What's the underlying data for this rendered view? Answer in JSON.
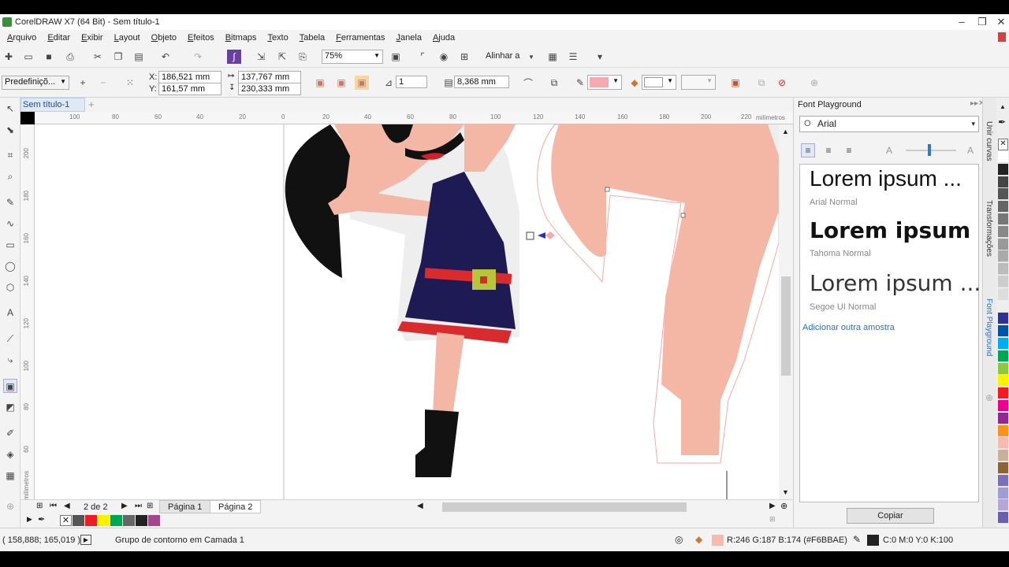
{
  "app": {
    "title": "CorelDRAW X7 (64 Bit) - Sem título-1"
  },
  "menu": [
    "Arquivo",
    "Editar",
    "Exibir",
    "Layout",
    "Objeto",
    "Efeitos",
    "Bitmaps",
    "Texto",
    "Tabela",
    "Ferramentas",
    "Janela",
    "Ajuda"
  ],
  "toolbar": {
    "zoom": "75%",
    "align_label": "Alinhar a"
  },
  "propbar": {
    "preset": "Predefiniçõ...",
    "x_label": "X:",
    "x": "186,521 mm",
    "y_label": "Y:",
    "y": "161,57 mm",
    "w": "137,767 mm",
    "h": "230,333 mm",
    "steps": "1",
    "offset": "8,368 mm"
  },
  "doc": {
    "tab": "Sem título-1"
  },
  "ruler": {
    "h_ticks": [
      "100",
      "80",
      "60",
      "40",
      "20",
      "0",
      "20",
      "40",
      "60",
      "80",
      "100",
      "120",
      "140",
      "160",
      "180",
      "200",
      "220"
    ],
    "h_unit": "milímetros",
    "v_ticks": [
      "200",
      "180",
      "160",
      "140",
      "120",
      "100",
      "80",
      "60"
    ],
    "v_unit": "milímetros"
  },
  "pages": {
    "counter": "2 de 2",
    "page1": "Página 1",
    "page2": "Página 2"
  },
  "status": {
    "coords": "( 158,888; 165,019 )",
    "message": "Grupo de contorno em Camada 1",
    "fill": "R:246 G:187 B:174 (#F6BBAE)",
    "outline": "C:0 M:0 Y:0 K:100",
    "fill_color": "#F6BBAE",
    "outline_color": "#222222"
  },
  "docker": {
    "title": "Font Playground",
    "font": "Arial",
    "samples": [
      {
        "text": "Lorem ipsum ...",
        "font": "Arial Normal"
      },
      {
        "text": "Lorem ipsum ...",
        "font": "Tahoma Normal"
      },
      {
        "text": "Lorem ipsum ...",
        "font": "Segoe UI Normal"
      }
    ],
    "add_sample": "Adicionar outra amostra",
    "copy": "Copiar"
  },
  "docker_tabs": [
    "Unir curvas",
    "Transformações",
    "Font Playground"
  ],
  "palette": {
    "bottom": [
      "#ee1c24",
      "#fff200",
      "#00a651",
      "#666666",
      "#222222",
      "#a3478c"
    ],
    "right": [
      "#ffffff",
      "#222222",
      "#444444",
      "#555555",
      "#666666",
      "#777777",
      "#888888",
      "#999999",
      "#aaaaaa",
      "#bbbbbb",
      "#cccccc",
      "#dddddd",
      "#eeeeee",
      "#2e3192",
      "#0054a6",
      "#00aeef",
      "#00a651",
      "#8dc63f",
      "#fff200",
      "#ed1c24",
      "#ec008c",
      "#92278f",
      "#f7941d",
      "#f6bbae",
      "#c7b299",
      "#8c6239",
      "#7b6fb5",
      "#9e9ed3",
      "#b4a7d6",
      "#6a5fa8"
    ]
  }
}
